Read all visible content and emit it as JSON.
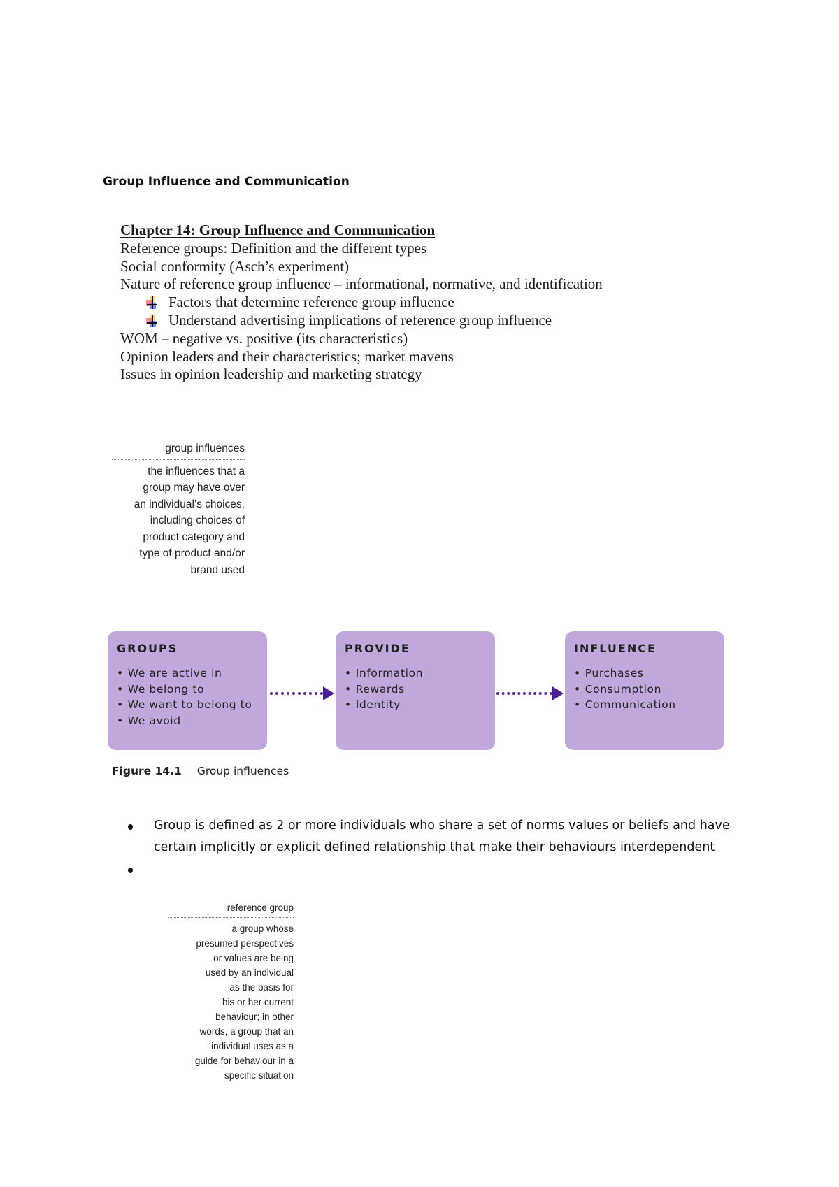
{
  "doc_heading": "Group Influence and Communication",
  "outline": {
    "chapter_title": "Chapter 14: Group Influence and Communication",
    "lines": [
      "Reference groups: Definition and the different types",
      "Social conformity (Asch’s experiment)",
      "Nature of reference group influence – informational, normative, and identification"
    ],
    "sub_items": [
      "Factors that determine reference group influence",
      "Understand advertising implications of reference group influence"
    ],
    "lines_after": [
      "WOM – negative vs. positive (its characteristics)",
      "Opinion leaders and their characteristics; market mavens",
      "Issues in opinion leadership and marketing strategy"
    ]
  },
  "definition_group_influences": {
    "term": "group influences",
    "lines": [
      "the influences that a",
      "group may have over",
      "an individual’s choices,",
      "including choices of",
      "product category and",
      "type of product and/or",
      "brand used"
    ]
  },
  "figure": {
    "boxes": [
      {
        "title": "GROUPS",
        "items": [
          "We are active in",
          "We belong to",
          "We want to belong to",
          "We avoid"
        ]
      },
      {
        "title": "PROVIDE",
        "items": [
          "Information",
          "Rewards",
          "Identity"
        ]
      },
      {
        "title": "INFLUENCE",
        "items": [
          "Purchases",
          "Consumption",
          "Communication"
        ]
      }
    ],
    "caption_number": "Figure 14.1",
    "caption_text": "Group influences",
    "box_color": "#c0a8dc",
    "arrow_color": "#4a2090"
  },
  "bullets": [
    "Group is defined as 2 or more individuals who share a set of norms values or beliefs and have certain implicitly or explicit defined relationship that make their behaviours interdependent",
    ""
  ],
  "definition_reference_group": {
    "term": "reference group",
    "lines": [
      "a group whose",
      "presumed perspectives",
      "or values are being",
      "used by an individual",
      "as the basis for",
      "his or her current",
      "behaviour; in other",
      "words, a group that an",
      "individual uses as a",
      "guide for behaviour in a",
      "specific situation"
    ]
  }
}
